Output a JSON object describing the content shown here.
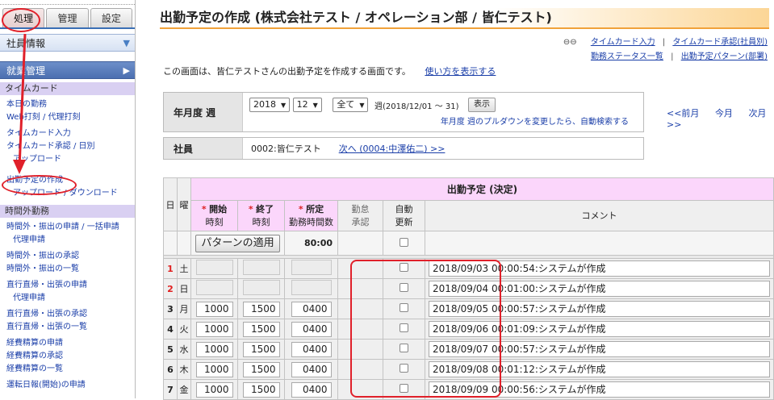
{
  "sidebar": {
    "tabs": [
      {
        "label": "処理"
      },
      {
        "label": "管理"
      },
      {
        "label": "設定"
      }
    ],
    "section_employee": "社員情報",
    "section_work": "就業管理",
    "cat_timecard": "タイムカード",
    "links_timecard": [
      "本日の勤務",
      "Web打刻 / 代理打刻",
      "タイムカード入力",
      "タイムカード承認 / 日別",
      "アップロード",
      "出勤予定の作成",
      "アップロード / ダウンロード"
    ],
    "cat_overtime": "時間外勤務",
    "links_overtime": [
      "時間外・振出の申請 / 一括申請",
      "代理申請",
      "時間外・振出の承認",
      "時間外・振出の一覧",
      "直行直帰・出張の申請",
      "代理申請",
      "直行直帰・出張の承認",
      "直行直帰・出張の一覧",
      "経費精算の申請",
      "経費精算の承認",
      "経費精算の一覧",
      "運転日報(開始)の申請"
    ]
  },
  "header": {
    "title": "出勤予定の作成 (株式会社テスト / オペレーション部 / 皆仁テスト)",
    "links_row1": [
      "タイムカード入力",
      "タイムカード承認(社員別)"
    ],
    "links_row2": [
      "勤務ステータス一覧",
      "出勤予定パターン(部署)"
    ]
  },
  "description": {
    "text": "この画面は、皆仁テストさんの出勤予定を作成する画面です。",
    "help_link": "使い方を表示する"
  },
  "filter": {
    "label": "年月度 週",
    "year": "2018",
    "month": "12",
    "week": "全て",
    "week_range": "週(2018/12/01 ～ 31)",
    "show_button": "表示",
    "hint": "年月度 週のプルダウンを変更したら、自動検索する",
    "nav_prev": "<<前月",
    "nav_current": "今月",
    "nav_next": "次月>>"
  },
  "employee": {
    "label": "社員",
    "value": "0002:皆仁テスト",
    "next_link": "次へ (0004:中澤佑二) >>"
  },
  "table": {
    "group_header": "出勤予定 (決定)",
    "col_day": "日",
    "col_weekday": "曜",
    "col_start_1": "開始",
    "col_start_2": "時刻",
    "col_end_1": "終了",
    "col_end_2": "時刻",
    "col_planned_1": "所定",
    "col_planned_2": "勤務時間数",
    "col_approve_1": "勤怠",
    "col_approve_2": "承認",
    "col_auto_1": "自動",
    "col_auto_2": "更新",
    "col_comment": "コメント",
    "required_mark": "*",
    "pattern_button": "パターンの適用",
    "total_hours": "80:00",
    "rows": [
      {
        "day": "1",
        "weekday": "土",
        "start": "",
        "end": "",
        "hours": "",
        "comment": "2018/09/03 00:00:54:システムが作成"
      },
      {
        "day": "2",
        "weekday": "日",
        "start": "",
        "end": "",
        "hours": "",
        "comment": "2018/09/04 00:01:00:システムが作成"
      },
      {
        "day": "3",
        "weekday": "月",
        "start": "1000",
        "end": "1500",
        "hours": "0400",
        "comment": "2018/09/05 00:00:57:システムが作成"
      },
      {
        "day": "4",
        "weekday": "火",
        "start": "1000",
        "end": "1500",
        "hours": "0400",
        "comment": "2018/09/06 00:01:09:システムが作成"
      },
      {
        "day": "5",
        "weekday": "水",
        "start": "1000",
        "end": "1500",
        "hours": "0400",
        "comment": "2018/09/07 00:00:57:システムが作成"
      },
      {
        "day": "6",
        "weekday": "木",
        "start": "1000",
        "end": "1500",
        "hours": "0400",
        "comment": "2018/09/08 00:01:12:システムが作成"
      },
      {
        "day": "7",
        "weekday": "金",
        "start": "1000",
        "end": "1500",
        "hours": "0400",
        "comment": "2018/09/09 00:00:56:システムが作成"
      }
    ]
  },
  "colors": {
    "accent_orange": "#f1a23a",
    "header_pink": "#fbd6fb",
    "sidebar_category": "#d9d0f2",
    "annotation_red": "#e0202a",
    "link_blue": "#1a3ea8"
  }
}
